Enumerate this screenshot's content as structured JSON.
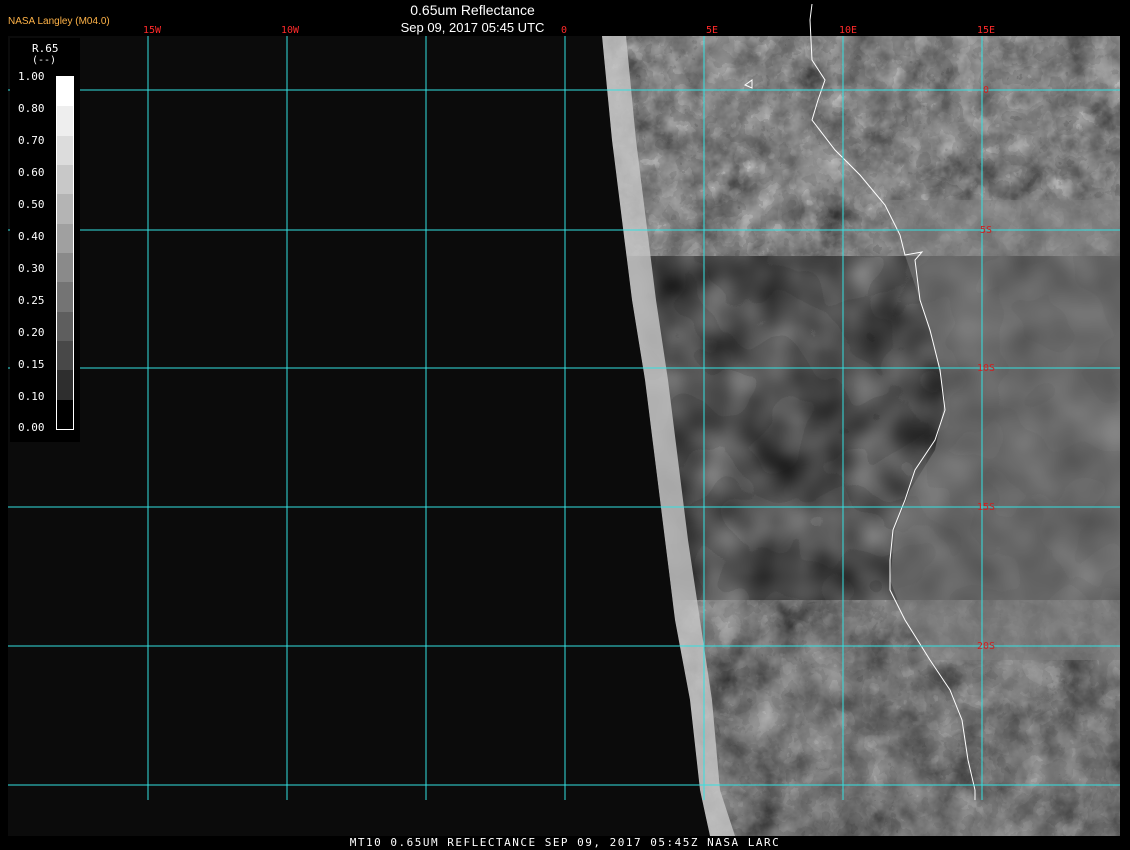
{
  "header": {
    "agency": "NASA Langley (M04.0)",
    "title": "0.65um Reflectance",
    "subtitle": "Sep 09, 2017 05:45 UTC"
  },
  "footer": "MT10  0.65UM REFLECTANCE   SEP 09, 2017 05:45Z   NASA LARC",
  "legend": {
    "variable": "R.65",
    "units": "(--)",
    "ticks": [
      "1.00",
      "0.80",
      "0.70",
      "0.60",
      "0.50",
      "0.40",
      "0.30",
      "0.25",
      "0.20",
      "0.15",
      "0.10",
      "0.00"
    ]
  },
  "map": {
    "lon_labels": [
      "15W",
      "10W",
      "0",
      "5E",
      "10E",
      "15E"
    ],
    "lat_labels": [
      "0",
      "5S",
      "10S",
      "15S",
      "20S"
    ],
    "colors": {
      "grid": "#33e0e0",
      "lon_label": "#ff2a2a",
      "lat_label": "#d21e1e",
      "coast": "#ffffff",
      "space": "#0b0b0b"
    }
  }
}
